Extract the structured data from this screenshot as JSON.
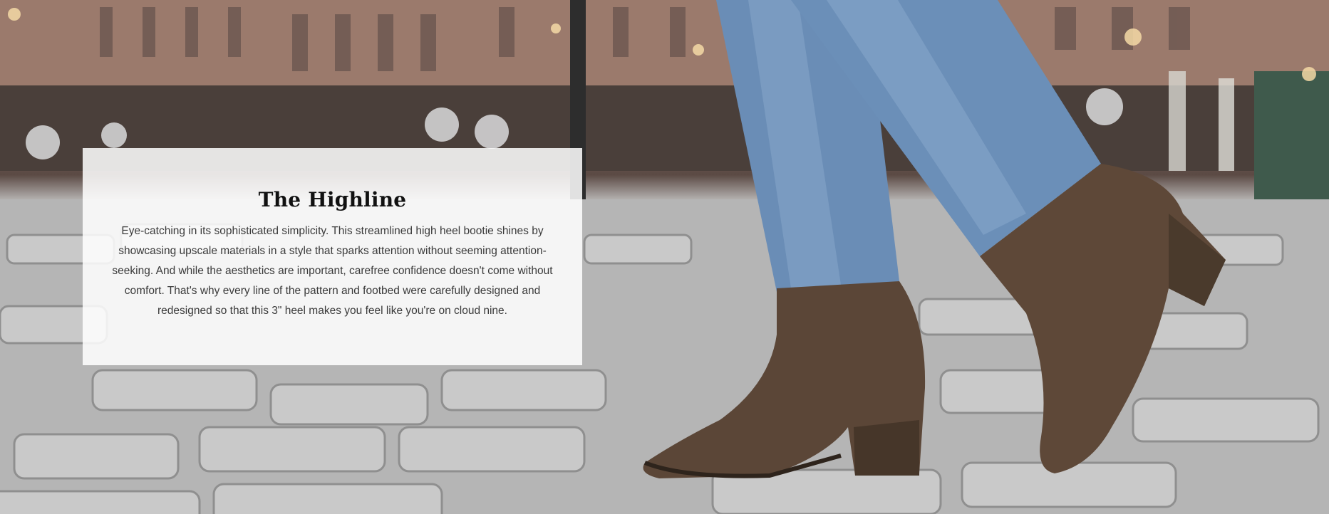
{
  "hero": {
    "image_alt": "Woman walking on cobblestone street wearing dark brown leather heeled ankle booties and light-wash jeans",
    "colors": {
      "cobblestone": "#b7b7b7",
      "building": "#9a786b",
      "denim": "#6b8fb8",
      "boot": "#5a4536",
      "card_bg": "#ffffff"
    }
  },
  "feature": {
    "title": "The Highline",
    "description": "Eye-catching in its sophisticated simplicity. This streamlined high heel bootie shines by showcasing upscale materials in a style that sparks attention without seeming attention-seeking. And while the aesthetics are important, carefree confidence doesn't come without comfort. That's why every line of the pattern and footbed were carefully designed and redesigned so that this 3\" heel makes you feel like you're on cloud nine."
  }
}
